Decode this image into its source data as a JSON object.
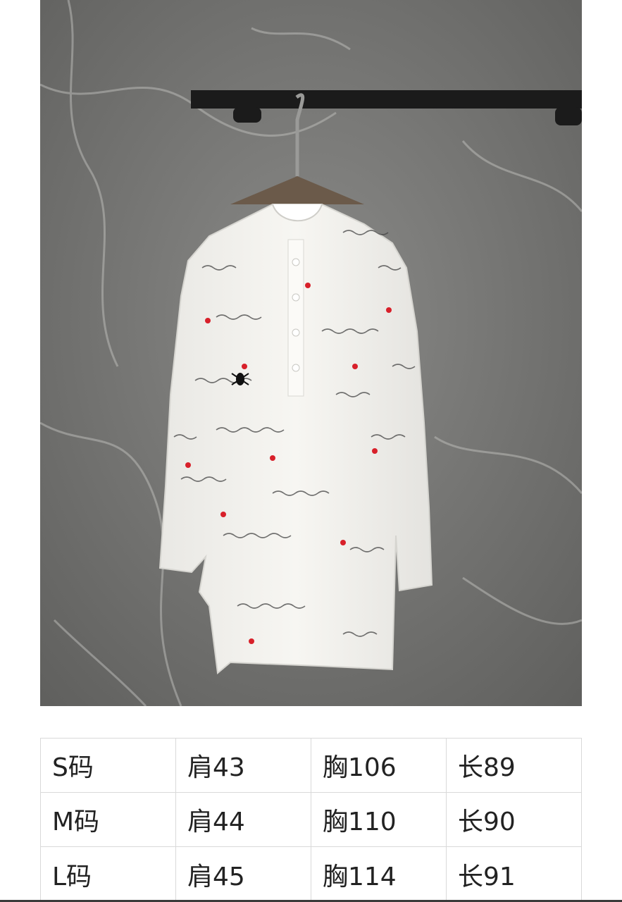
{
  "photo": {
    "subject": "product-photo",
    "colors": {
      "wall": "#7c7c7a",
      "shirt": "#f4f3ef",
      "script": "#3a3a3a",
      "heart": "#d8202a",
      "rail": "#1b1b1b"
    }
  },
  "size_table": {
    "rows": [
      [
        "S码",
        "肩43",
        "胸106",
        "长89"
      ],
      [
        "M码",
        "肩44",
        "胸110",
        "长90"
      ],
      [
        "L码",
        "肩45",
        "胸114",
        "长91"
      ]
    ]
  }
}
